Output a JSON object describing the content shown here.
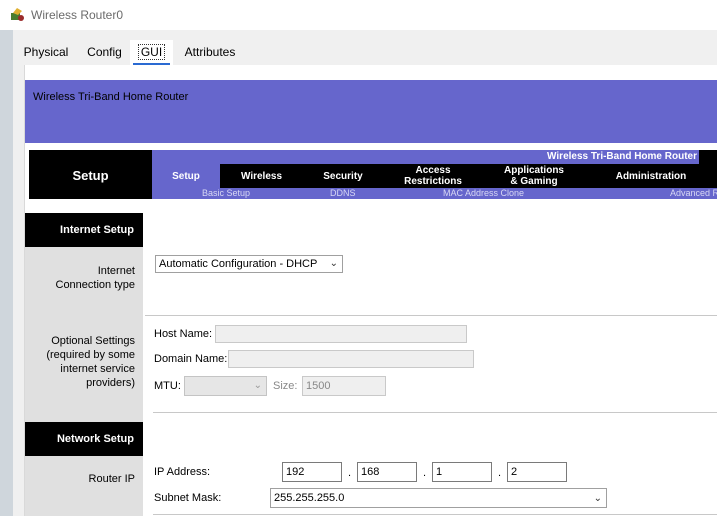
{
  "window": {
    "title": "Wireless Router0",
    "icon": "router-icon"
  },
  "tabs": [
    {
      "label": "Physical"
    },
    {
      "label": "Config"
    },
    {
      "label": "GUI",
      "active": true
    },
    {
      "label": "Attributes"
    }
  ],
  "banner": {
    "title": "Wireless Tri-Band Home Router"
  },
  "menu": {
    "section_title": "Setup",
    "product_name": "Wireless Tri-Band Home Router",
    "items": [
      "Setup",
      "Wireless",
      "Security",
      "Access Restrictions",
      "Applications & Gaming",
      "Administration"
    ],
    "access_line1": "Access",
    "access_line2": "Restrictions",
    "apps_line1": "Applications",
    "apps_line2": "& Gaming",
    "subitems": [
      "Basic Setup",
      "DDNS",
      "MAC Address Clone",
      "Advanced R"
    ]
  },
  "internet_setup": {
    "header": "Internet Setup",
    "connection_label_1": "Internet",
    "connection_label_2": "Connection type",
    "connection_value": "Automatic Configuration - DHCP",
    "optional_label_1": "Optional Settings",
    "optional_label_2": "(required by some",
    "optional_label_3": "internet service",
    "optional_label_4": "providers)",
    "host_name_label": "Host Name:",
    "host_name_value": "",
    "domain_name_label": "Domain Name:",
    "domain_name_value": "",
    "mtu_label": "MTU:",
    "mtu_value": "",
    "size_label": "Size:",
    "size_value": "1500"
  },
  "network_setup": {
    "header": "Network Setup",
    "router_ip_label": "Router IP",
    "ip_address_label": "IP Address:",
    "ip_octets": [
      "192",
      "168",
      "1",
      "2"
    ],
    "subnet_mask_label": "Subnet Mask:",
    "subnet_mask_value": "255.255.255.0"
  },
  "colors": {
    "brand_purple": "#6666cc",
    "header_black": "#000000",
    "sidebar_grey": "#e0e0e0"
  }
}
